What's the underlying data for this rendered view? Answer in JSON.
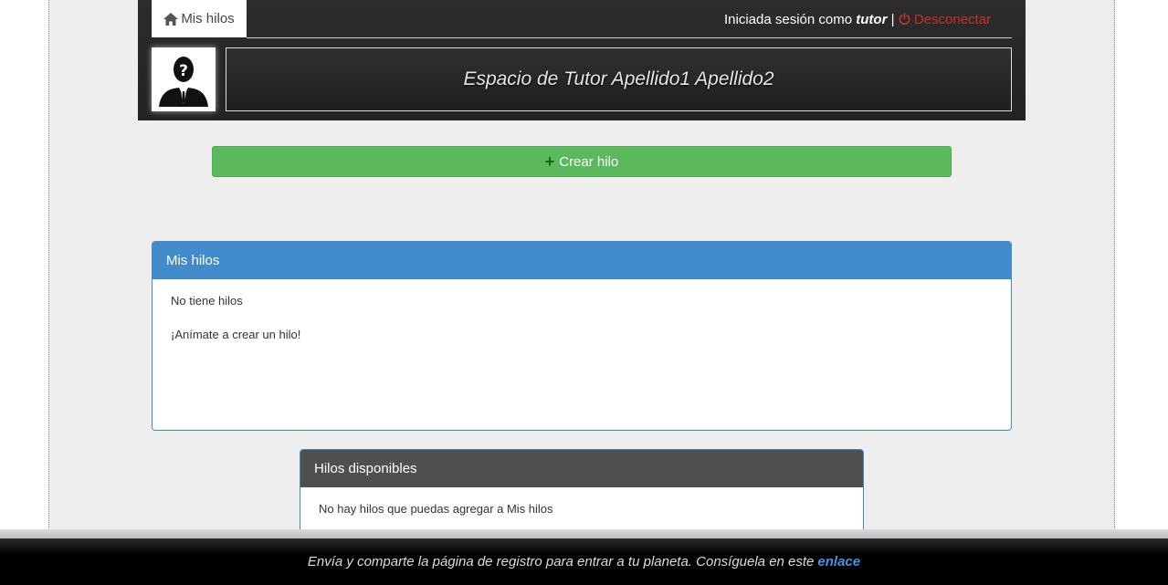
{
  "header": {
    "tab_label": "Mis hilos",
    "session_prefix": "Iniciada sesión como",
    "username": "tutor",
    "separator": "|",
    "logout_label": "Desconectar",
    "space_title": "Espacio de Tutor Apellido1 Apellido2"
  },
  "actions": {
    "create_label": "Crear hilo"
  },
  "my_threads": {
    "heading": "Mis hilos",
    "empty_text": "No tiene hilos",
    "encourage_text": "¡Anímate a crear un hilo!"
  },
  "available_threads": {
    "heading": "Hilos disponibles",
    "empty_text": "No hay hilos que puedas agregar a Mis hilos"
  },
  "footer": {
    "text": "Envía y comparte la página de registro para entrar a tu planeta. Consíguela en este",
    "link_label": "enlace"
  },
  "colors": {
    "primary": "#428bca",
    "success": "#5cb85c",
    "danger": "#c9302c",
    "header_bg": "#2c2c2c"
  }
}
